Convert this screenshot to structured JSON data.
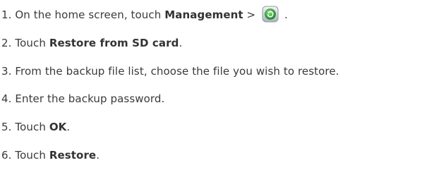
{
  "steps": [
    {
      "number": "1.",
      "pre": "On the home screen, touch ",
      "bold": "Management",
      "post": " > ",
      "icon": "backup-app-icon",
      "end": " ."
    },
    {
      "number": "2.",
      "pre": "Touch ",
      "bold": "Restore from SD card",
      "post": "."
    },
    {
      "number": "3.",
      "text": "From the backup file list, choose the file you wish to restore."
    },
    {
      "number": "4.",
      "text": "Enter the backup password."
    },
    {
      "number": "5.",
      "pre": "Touch ",
      "bold": "OK",
      "post": "."
    },
    {
      "number": "6.",
      "pre": "Touch ",
      "bold": "Restore",
      "post": "."
    }
  ],
  "colors": {
    "text": "#3a3a3a",
    "icon_green": "#4caf50",
    "icon_frame": "#b9c2c8"
  }
}
